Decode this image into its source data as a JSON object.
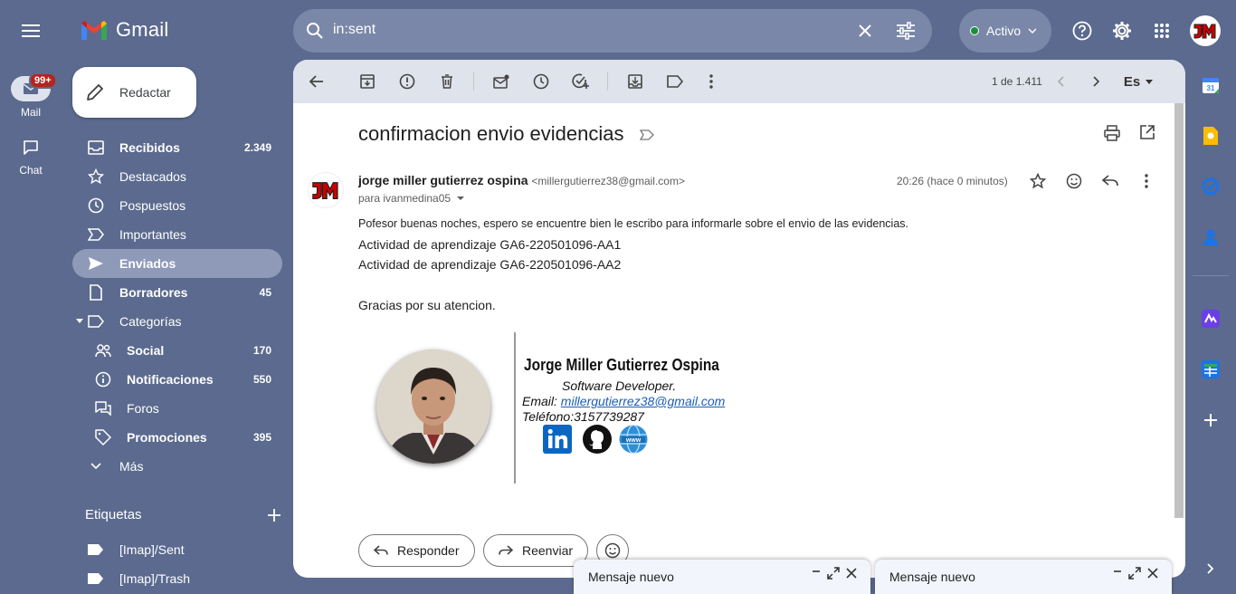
{
  "app": {
    "logo_text": "Gmail"
  },
  "rail": {
    "mail_label": "Mail",
    "mail_badge": "99+",
    "chat_label": "Chat"
  },
  "search": {
    "query": "in:sent"
  },
  "status": {
    "label": "Activo",
    "color": "#1e8e3e"
  },
  "compose_button": {
    "label": "Redactar"
  },
  "nav": {
    "items": [
      {
        "label": "Recibidos",
        "count": "2.349",
        "icon": "inbox-icon",
        "bold": true
      },
      {
        "label": "Destacados",
        "count": "",
        "icon": "star-icon",
        "bold": false
      },
      {
        "label": "Pospuestos",
        "count": "",
        "icon": "clock-icon",
        "bold": false
      },
      {
        "label": "Importantes",
        "count": "",
        "icon": "important-icon",
        "bold": false
      },
      {
        "label": "Enviados",
        "count": "",
        "icon": "send-icon",
        "bold": true,
        "selected": true
      },
      {
        "label": "Borradores",
        "count": "45",
        "icon": "draft-icon",
        "bold": true
      },
      {
        "label": "Categorías",
        "count": "",
        "icon": "label-icon",
        "bold": false
      }
    ],
    "categories": [
      {
        "label": "Social",
        "count": "170",
        "icon": "people-icon"
      },
      {
        "label": "Notificaciones",
        "count": "550",
        "icon": "info-icon"
      },
      {
        "label": "Foros",
        "count": "",
        "icon": "forum-icon"
      },
      {
        "label": "Promociones",
        "count": "395",
        "icon": "tag-icon"
      }
    ],
    "more_label": "Más"
  },
  "labels": {
    "title": "Etiquetas",
    "items": [
      "[Imap]/Sent",
      "[Imap]/Trash"
    ]
  },
  "toolbar": {
    "pager": "1 de 1.411",
    "lang": "Es"
  },
  "email": {
    "subject": "confirmacion envio evidencias",
    "sender_name": "jorge miller gutierrez ospina",
    "sender_email": "<millergutierrez38@gmail.com>",
    "to": "para ivanmedina05",
    "time": "20:26 (hace 0 minutos)",
    "body_intro": "Pofesor buenas noches, espero se encuentre bien le escribo para informarle sobre el envio de las evidencias.",
    "body_line1": "Actividad de aprendizaje GA6-220501096-AA1",
    "body_line2": "Actividad de aprendizaje GA6-220501096-AA2",
    "body_thanks": "Gracias por su atencion."
  },
  "signature": {
    "name": "Jorge Miller Gutierrez Ospina",
    "role": "Software Developer.",
    "email_label": "Email: ",
    "email": "millergutierrez38@gmail.com",
    "phone": "Teléfono:3157739287",
    "www_label": "www"
  },
  "actions": {
    "reply": "Responder",
    "forward": "Reenviar"
  },
  "compose_windows": [
    {
      "title": "Mensaje nuevo"
    },
    {
      "title": "Mensaje nuevo"
    }
  ],
  "colors": {
    "background": "#5b6a8e",
    "selected_nav": "#8e9ab8",
    "badge": "#b3261e"
  }
}
